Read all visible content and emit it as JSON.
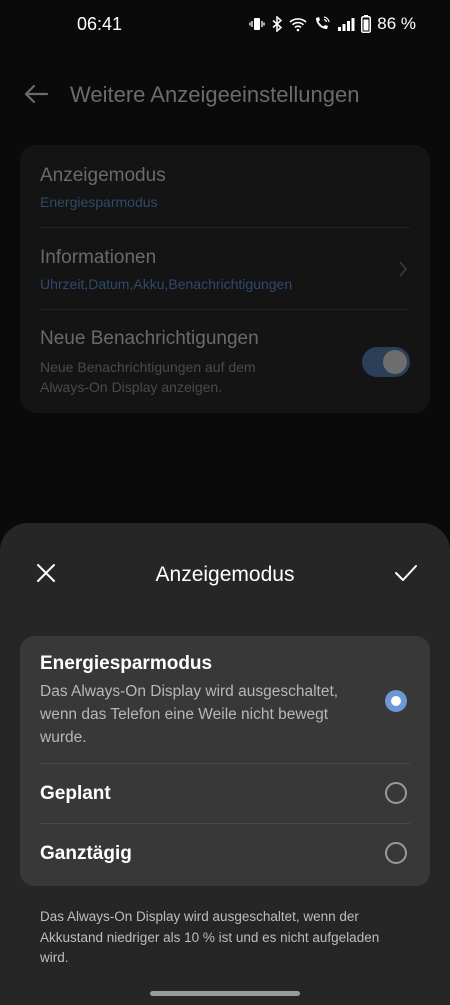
{
  "status_bar": {
    "time": "06:41",
    "battery": "86 %",
    "icons": [
      "vibrate-icon",
      "bluetooth-icon",
      "wifi-icon",
      "wifi-calling-icon",
      "signal-icon",
      "battery-icon"
    ]
  },
  "header": {
    "title": "Weitere Anzeigeeinstellungen",
    "back_icon": "arrow-left-icon"
  },
  "settings": {
    "items": [
      {
        "title": "Anzeigemodus",
        "subtitle": "Energiesparmodus"
      },
      {
        "title": "Informationen",
        "subtitle": "Uhrzeit,Datum,Akku,Benachrichtigungen"
      },
      {
        "title": "Neue Benachrichtigungen",
        "subtitle": "Neue Benachrichtigungen auf dem Always-On Display anzeigen.",
        "toggle_on": true
      }
    ]
  },
  "sheet": {
    "title": "Anzeigemodus",
    "close_icon": "close-icon",
    "confirm_icon": "check-icon",
    "options": [
      {
        "title": "Energiesparmodus",
        "description": "Das Always-On Display wird ausgeschaltet, wenn das Telefon eine Weile nicht bewegt wurde.",
        "selected": true
      },
      {
        "title": "Geplant",
        "selected": false
      },
      {
        "title": "Ganztägig",
        "selected": false
      }
    ],
    "footnote": "Das Always-On Display wird ausgeschaltet, wenn der Akkustand niedriger als 10 % ist und es nicht aufgeladen wird."
  },
  "colors": {
    "accent": "#6e97d6",
    "sheet_bg": "#262626",
    "card_bg": "#383838"
  }
}
